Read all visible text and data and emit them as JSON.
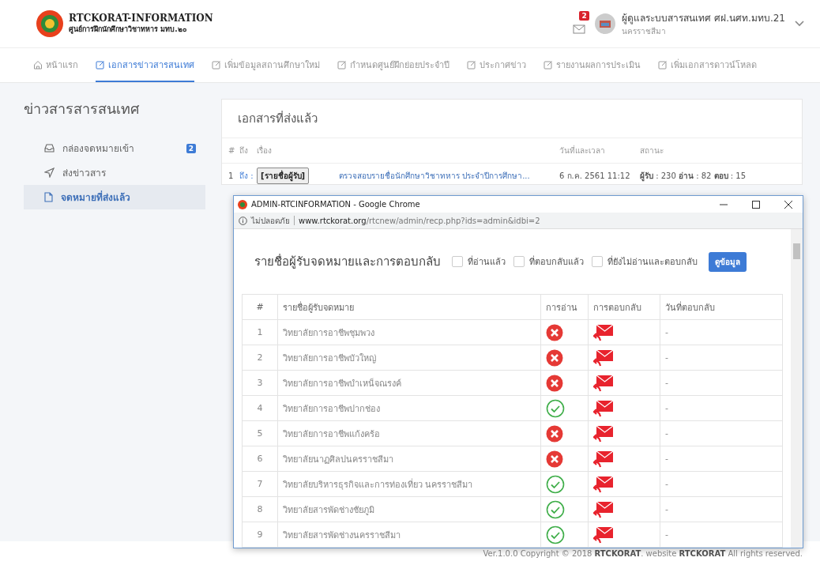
{
  "brand": {
    "title": "RTCKORAT-INFORMATION",
    "subtitle": "ศูนย์การฝึกนักศึกษาวิชาทหาร มทบ.๒๐"
  },
  "user": {
    "mail_count": "2",
    "name": "ผู้ดูแลระบบสารสนเทศ ศฝ.นศท.มทบ.21",
    "location": "นครราชสีมา"
  },
  "nav": [
    {
      "label": "หน้าแรก",
      "kind": "home",
      "selected": false
    },
    {
      "label": "เอกสารข่าวสารสนเทศ",
      "kind": "edit",
      "selected": true
    },
    {
      "label": "เพิ่มข้อมูลสถานศึกษาใหม่",
      "kind": "edit",
      "selected": false
    },
    {
      "label": "กำหนดศูนย์ฝึกย่อยประจำปี",
      "kind": "edit",
      "selected": false
    },
    {
      "label": "ประกาศข่าว",
      "kind": "edit",
      "selected": false
    },
    {
      "label": "รายงานผลการประเมิน",
      "kind": "edit",
      "selected": false
    },
    {
      "label": "เพิ่มเอกสารดาวน์โหลด",
      "kind": "edit",
      "selected": false
    }
  ],
  "sidebar": {
    "title": "ข่าวสารสารสนเทศ",
    "items": [
      {
        "label": "กล่องจดหมายเข้า",
        "kind": "inbox",
        "badge": "2",
        "selected": false
      },
      {
        "label": "ส่งข่าวสาร",
        "kind": "send",
        "selected": false
      },
      {
        "label": "จดหมายที่ส่งแล้ว",
        "kind": "file",
        "selected": true
      }
    ]
  },
  "sent": {
    "title": "เอกสารที่ส่งแล้ว",
    "columns": [
      "#",
      "ถึง",
      "เรื่อง",
      "วันที่และเวลา",
      "สถานะ"
    ],
    "rows": [
      {
        "index": "1",
        "to": "ถึง :",
        "button": "[รายชื่อผู้รับ]",
        "subject": "ตรวจสอบรายชื่อนักศึกษาวิชาทหาร ประจำปีการศึกษา...",
        "date": "6 ก.ค. 2561 11:12",
        "status": "**ผู้รับ** : 230 **อ่าน** : 82 **ตอบ** : 15"
      }
    ]
  },
  "popup": {
    "title": "ADMIN-RTCINFORMATION - Google Chrome",
    "security": "ไม่ปลอดภัย",
    "url_host": "www.rtckorat.org",
    "url_path": "/rtcnew/admin/recp.php?ids=admin&idbi=2",
    "heading": "รายชื่อผู้รับจดหมายและการตอบกลับ",
    "filters": [
      {
        "label": "ที่อ่านแล้ว",
        "checked": false
      },
      {
        "label": "ที่ตอบกลับแล้ว",
        "checked": false
      },
      {
        "label": "ที่ยังไม่อ่านและตอบกลับ",
        "checked": false
      }
    ],
    "view_button": "ดูข้อมูล",
    "columns": [
      "#",
      "รายชื่อผู้รับจดหมาย",
      "การอ่าน",
      "การตอบกลับ",
      "วันที่ตอบกลับ"
    ],
    "rows": [
      {
        "index": "1",
        "name": "วิทยาลัยการอาชีพชุมพวง",
        "read": false,
        "reply_date": "-"
      },
      {
        "index": "2",
        "name": "วิทยาลัยการอาชีพบัวใหญ่",
        "read": false,
        "reply_date": "-"
      },
      {
        "index": "3",
        "name": "วิทยาลัยการอาชีพบำเหน็จณรงค์",
        "read": false,
        "reply_date": "-"
      },
      {
        "index": "4",
        "name": "วิทยาลัยการอาชีพปากช่อง",
        "read": true,
        "reply_date": "-"
      },
      {
        "index": "5",
        "name": "วิทยาลัยการอาชีพแก้งคร้อ",
        "read": false,
        "reply_date": "-"
      },
      {
        "index": "6",
        "name": "วิทยาลัยนาฏศิลปนครราชสีมา",
        "read": false,
        "reply_date": "-"
      },
      {
        "index": "7",
        "name": "วิทยาลัยบริหารธุรกิจและการท่องเที่ยว นครราชสีมา",
        "read": true,
        "reply_date": "-"
      },
      {
        "index": "8",
        "name": "วิทยาลัยสารพัดช่างชัยภูมิ",
        "read": true,
        "reply_date": "-"
      },
      {
        "index": "9",
        "name": "วิทยาลัยสารพัดช่างนครราชสีมา",
        "read": true,
        "reply_date": "-"
      }
    ]
  },
  "footer": "Ver.1.0.0 Copyright © 2018 **RTCKORAT**. website **RTCKORAT** All rights reserved."
}
